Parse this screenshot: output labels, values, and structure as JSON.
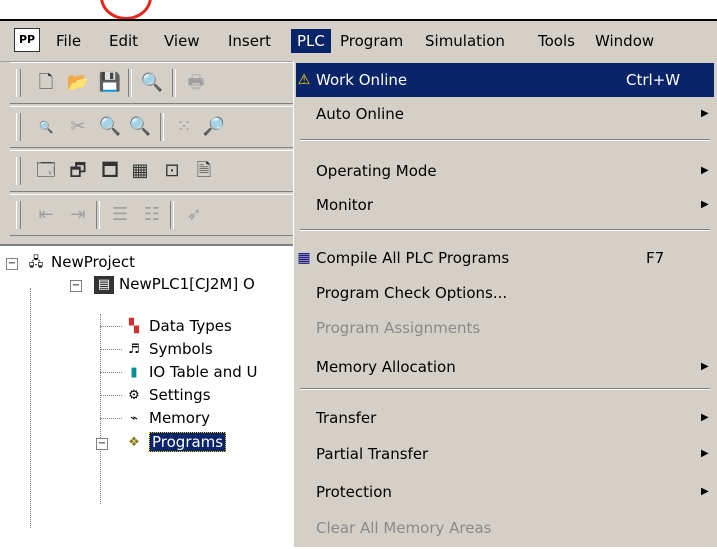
{
  "menubar": {
    "items": [
      "File",
      "Edit",
      "View",
      "Insert",
      "PLC",
      "Program",
      "Simulation",
      "Tools",
      "Window"
    ],
    "active": "PLC"
  },
  "plc_menu": {
    "items": [
      {
        "label": "Work Online",
        "shortcut": "Ctrl+W",
        "icon": "warning-icon",
        "state": "highlighted"
      },
      {
        "label": "Auto Online",
        "submenu": true
      },
      {
        "label": "Operating Mode",
        "submenu": true
      },
      {
        "label": "Monitor",
        "submenu": true
      },
      {
        "label": "Compile All PLC Programs",
        "shortcut": "F7",
        "icon": "compile-icon"
      },
      {
        "label": "Program Check Options..."
      },
      {
        "label": "Program Assignments",
        "state": "disabled"
      },
      {
        "label": "Memory Allocation",
        "submenu": true
      },
      {
        "label": "Transfer",
        "submenu": true
      },
      {
        "label": "Partial Transfer",
        "submenu": true
      },
      {
        "label": "Protection",
        "submenu": true
      },
      {
        "label": "Clear All Memory Areas",
        "state": "disabled"
      }
    ]
  },
  "tree": {
    "project": "NewProject",
    "plc": "NewPLC1[CJ2M] O",
    "children": [
      "Data Types",
      "Symbols",
      "IO Table and U",
      "Settings",
      "Memory",
      "Programs"
    ],
    "selected": "Programs"
  },
  "colors": {
    "highlight": "#0a246a",
    "menubg": "#d4d0c8",
    "annotation": "#e8251c"
  }
}
